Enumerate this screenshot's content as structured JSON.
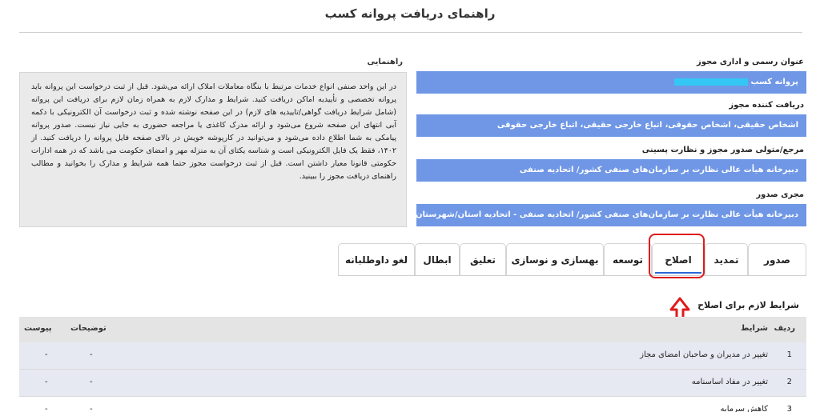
{
  "page": {
    "title": "راهنمای دریافت پروانه کسب"
  },
  "help": {
    "label": "راهنمایی",
    "text": "در این واحد صنفی انواع خدمات مرتبط با  بنگاه معاملات املاک ارائه می‌شود. قبل از ثبت درخواست این پروانه باید پروانه تخصصی و تأییدیه اماکن  دریافت کنید. شرایط و مدارک لازم به همراه زمان لازم برای دریافت این پروانه (شامل شرایط دریافت گواهی/تاییدیه های لازم) در این صفحه نوشته شده و ثبت درخواست آن الکترونیکی با دکمه آبی انتهای این صفحه شروع می‌شود و ارائه مدرک کاغذی یا مراجعه حضوری به جایی نیاز نیست. صدور پروانه  پیامکی به شما اطلاع داده می‌شود و می‌توانید در کارپوشه خویش در بالای صفحه فایل پروانه را دریافت کنید. از ۱۴۰۲، فقط یک فایل الکترونیکی است و شناسه یکتای آن به منزله مهر و امضای حکومت می باشد که در همه ادارات حکومتی قانونا معیار داشتن  است. قبل از ثبت درخواست مجوز حتما همه شرایط و مدارک را بخوانید و مطالب راهنمای دریافت مجوز را ببینید."
  },
  "fields": [
    {
      "label": "عنوان رسمی و اداری مجوز",
      "value": "پروانه کسب"
    },
    {
      "label": "دریافت کننده مجوز",
      "value": "اشخاص حقیقی، اشخاص حقوقی، اتباع خارجی حقیقی، اتباع خارجی حقوقی"
    },
    {
      "label": "مرجع/متولی صدور مجوز و نظارت پسینی",
      "value": "دبیرخانه هیأت عالی نظارت بر سازمان‌های صنفی کشور/ اتحادیه صنفی"
    },
    {
      "label": "مجری صدور",
      "value": "دبیرخانه هیأت عالی نظارت بر سازمان‌های صنفی کشور/ اتحادیه صنفی - اتحادیه استان/شهرستان"
    }
  ],
  "tabs": [
    {
      "label": "صدور"
    },
    {
      "label": "تمدید"
    },
    {
      "label": "اصلاح"
    },
    {
      "label": "توسعه"
    },
    {
      "label": "بهسازی و نوسازی"
    },
    {
      "label": "تعلیق"
    },
    {
      "label": "ابطال"
    },
    {
      "label": "لغو داوطلبانه"
    }
  ],
  "active_tab": "اصلاح",
  "section": {
    "title": "شرایط لازم برای اصلاح"
  },
  "table": {
    "headers": {
      "row": "ردیف",
      "condition": "شرایط",
      "notes": "توضیحات",
      "attachment": "پیوست"
    },
    "rows": [
      {
        "num": "1",
        "condition": "تغییر در مدیران و صاحبان امضای مجاز",
        "notes": "-",
        "attachment": "-"
      },
      {
        "num": "2",
        "condition": "تغییر در مفاد اساسنامه",
        "notes": "-",
        "attachment": "-"
      },
      {
        "num": "3",
        "condition": "کاهش سرمایه",
        "notes": "-",
        "attachment": "-"
      }
    ]
  },
  "colors": {
    "field_bg": "#6f97e6",
    "highlight": "#e01b1b",
    "active_underline": "#2a67d6",
    "redaction": "#34c6f5"
  }
}
